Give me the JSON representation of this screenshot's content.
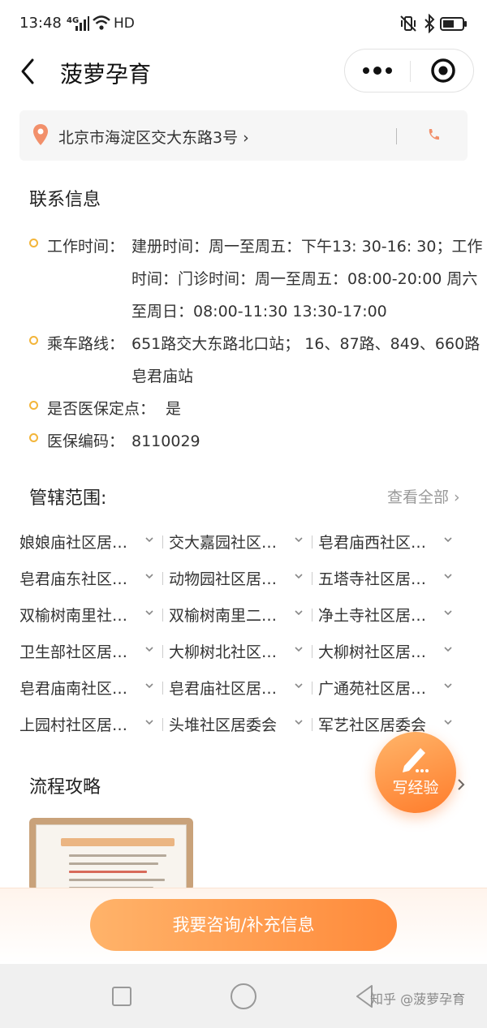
{
  "status_bar": {
    "time": "13:48",
    "network": "4G",
    "hd": "HD"
  },
  "nav": {
    "title": "菠萝孕育"
  },
  "address": {
    "text": "北京市海淀区交大东路3号 ›"
  },
  "contact": {
    "title": "联系信息",
    "rows": [
      {
        "label": "工作时间：",
        "value": "建册时间：周一至周五：下午13: 30-16: 30；工作时间：门诊时间：周一至周五：08:00-20:00 周六至周日：08:00-11:30 13:30-17:00"
      },
      {
        "label": "乘车路线：",
        "value": "651路交大东路北口站； 16、87路、849、660路皂君庙站"
      },
      {
        "label": "是否医保定点：",
        "value": "是"
      },
      {
        "label": "医保编码：",
        "value": "8110029"
      }
    ]
  },
  "jurisdiction": {
    "title": "管辖范围:",
    "view_all": "查看全部 ›",
    "items": [
      "娘娘庙社区居…",
      "交大嘉园社区…",
      "皂君庙西社区…",
      "皂君庙东社区…",
      "动物园社区居…",
      "五塔寺社区居…",
      "双榆树南里社…",
      "双榆树南里二…",
      "净土寺社区居…",
      "卫生部社区居…",
      "大柳树北社区…",
      "大柳树社区居…",
      "皂君庙南社区…",
      "皂君庙社区居…",
      "广通苑社区居…",
      "上园村社区居…",
      "头堆社区居委会",
      "军艺社区居委会"
    ]
  },
  "strategy": {
    "title": "流程攻略"
  },
  "fab": {
    "label": "写经验"
  },
  "cta": {
    "label": "我要咨询/补充信息"
  },
  "watermark": "知乎 @菠萝孕育",
  "colors": {
    "accent": "#ff8a3a",
    "dot": "#f3b53a",
    "pin": "#f2906b"
  },
  "icons": [
    "back-icon",
    "more-icon",
    "target-icon",
    "location-pin-icon",
    "phone-icon",
    "chevron-down-icon",
    "chevron-right-icon",
    "pencil-icon"
  ]
}
